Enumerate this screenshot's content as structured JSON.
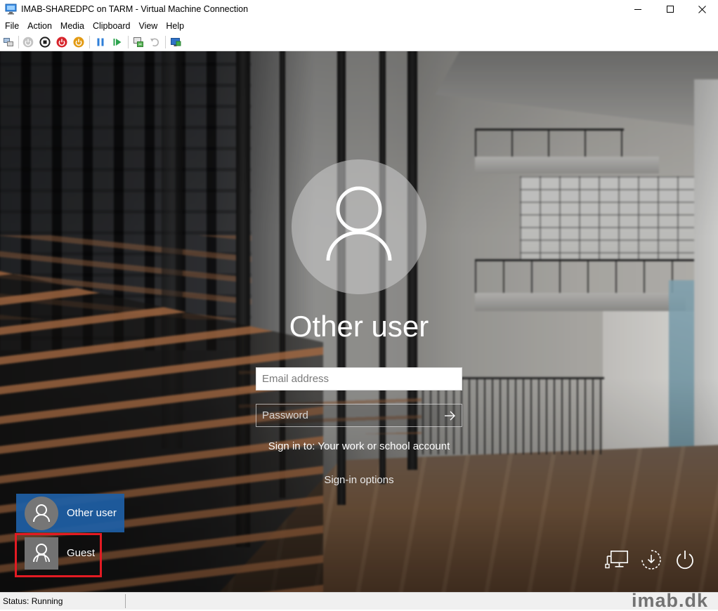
{
  "window": {
    "title": "IMAB-SHAREDPC on TARM - Virtual Machine Connection",
    "app_icon": "vm-connection-icon",
    "controls": [
      "minimize-icon",
      "maximize-icon",
      "close-icon"
    ]
  },
  "menu": [
    "File",
    "Action",
    "Media",
    "Clipboard",
    "View",
    "Help"
  ],
  "toolbar": {
    "buttons": [
      {
        "icon": "ctrl-alt-del-icon",
        "enabled": true
      },
      {
        "icon": "start-icon",
        "enabled": false
      },
      {
        "icon": "turn-off-icon",
        "enabled": true
      },
      {
        "icon": "shut-down-icon",
        "enabled": true
      },
      {
        "icon": "save-icon",
        "enabled": true
      },
      {
        "icon": "pause-icon",
        "enabled": true
      },
      {
        "icon": "reset-icon",
        "enabled": true
      },
      {
        "icon": "checkpoint-icon",
        "enabled": true
      },
      {
        "icon": "revert-icon",
        "enabled": false
      },
      {
        "icon": "enhanced-session-icon",
        "enabled": true
      }
    ]
  },
  "login": {
    "account_name": "Other user",
    "email_placeholder": "Email address",
    "password_placeholder": "Password",
    "sign_in_to": "Sign in to: Your work or school account",
    "sign_in_options": "Sign-in options"
  },
  "user_list": [
    {
      "name": "Other user",
      "selected": true,
      "avatar": "user-icon"
    },
    {
      "name": "Guest",
      "selected": false,
      "highlighted": true,
      "avatar": "guest-icon"
    }
  ],
  "system_buttons": [
    "network-icon",
    "ease-of-access-icon",
    "power-icon"
  ],
  "status": {
    "text": "Status: Running"
  },
  "watermark": "imab.dk",
  "colors": {
    "selected_tile": "#1e5fa5",
    "highlight_frame": "#e31b23",
    "title_bar": "#ffffff",
    "status_bar": "#f0f0f0"
  }
}
